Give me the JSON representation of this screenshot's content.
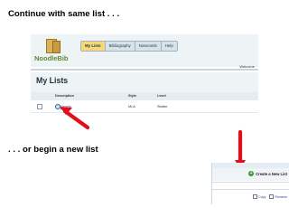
{
  "headings": {
    "continue": "Continue with same list . . .",
    "new_list": ". . . or begin a new list"
  },
  "shot1": {
    "logo_text": "NoodleBib",
    "tabs": [
      "My Lists",
      "Bibliography",
      "Notecards",
      "Help"
    ],
    "active_tab": "My Lists",
    "welcome": "Welcome",
    "page_title": "My Lists",
    "columns": [
      "Description",
      "Style",
      "Level"
    ],
    "row": {
      "description": "Nevels",
      "style": "MLA",
      "level": "Starter"
    }
  },
  "shot2": {
    "create_button": "Create a New List",
    "actions": [
      "Copy",
      "Rename"
    ]
  },
  "colors": {
    "arrow": "#e0101a",
    "active_tab": "#f6d878",
    "link": "#1f4fa3",
    "plus_icon": "#3c9a33"
  },
  "icons": [
    "book-logo-icon",
    "list-icon",
    "plus-icon",
    "copy-icon",
    "rename-icon",
    "red-arrow-icon"
  ]
}
